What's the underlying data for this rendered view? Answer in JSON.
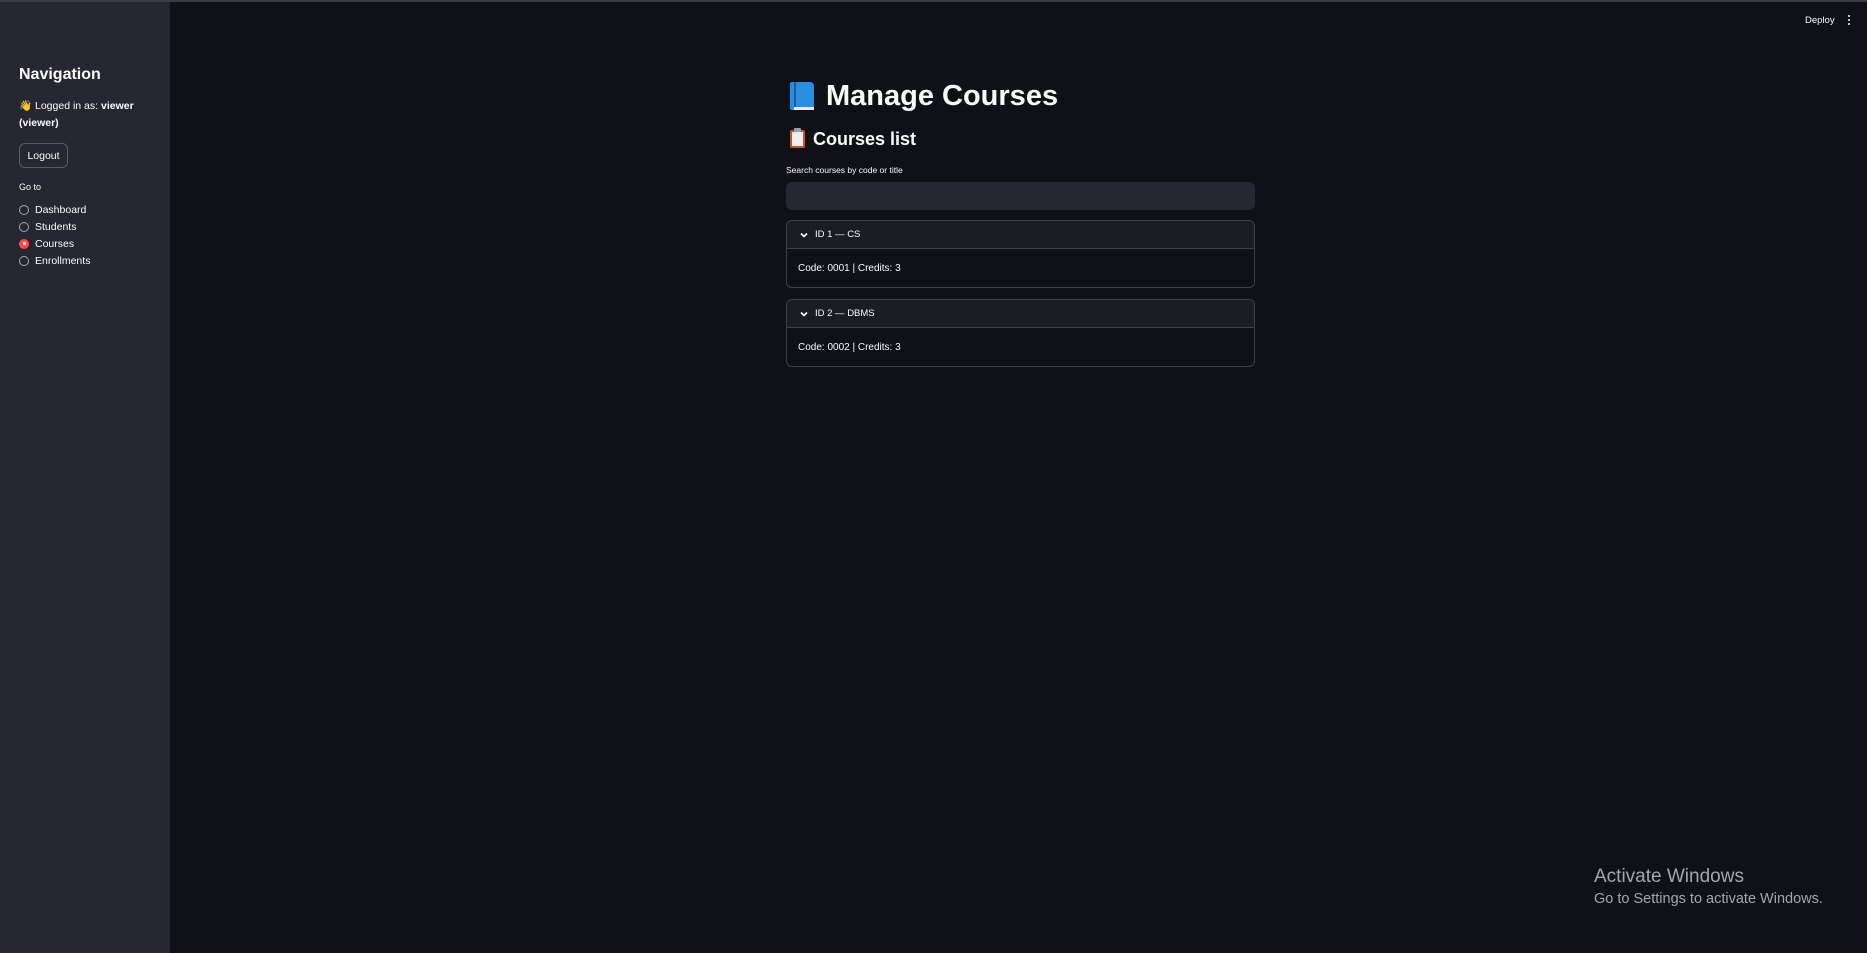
{
  "header": {
    "deploy_label": "Deploy",
    "menu_icon": "kebab-menu-icon"
  },
  "sidebar": {
    "title": "Navigation",
    "login_prefix": "Logged in as:",
    "username": "viewer",
    "role": "(viewer)",
    "logout_label": "Logout",
    "goto_label": "Go to",
    "items": [
      {
        "label": "Dashboard",
        "selected": false
      },
      {
        "label": "Students",
        "selected": false
      },
      {
        "label": "Courses",
        "selected": true
      },
      {
        "label": "Enrollments",
        "selected": false
      }
    ],
    "selected_color": "#ff4b4b"
  },
  "main": {
    "title": "Manage Courses",
    "title_icon": "blue-book-icon",
    "subtitle": "Courses list",
    "subtitle_icon": "clipboard-icon",
    "search_label": "Search courses by code or title",
    "search_value": "",
    "courses": [
      {
        "header": "ID 1 — CS",
        "body": "Code: 0001 | Credits: 3"
      },
      {
        "header": "ID 2 — DBMS",
        "body": "Code: 0002 | Credits: 3"
      }
    ]
  },
  "watermark": {
    "line1": "Activate Windows",
    "line2": "Go to Settings to activate Windows."
  }
}
